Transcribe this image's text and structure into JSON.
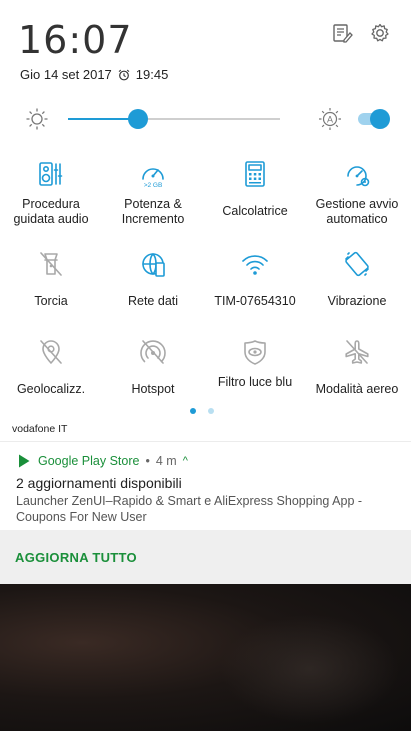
{
  "status": {
    "time": "16:07",
    "date": "Gio 14 set 2017",
    "alarm_time": "19:45",
    "icons": [
      "edit-notes-icon",
      "settings-gear-icon",
      "alarm-clock-icon"
    ]
  },
  "brightness": {
    "level": 0.33,
    "auto_enabled": true,
    "icons": [
      "brightness-sun-icon",
      "auto-brightness-icon"
    ]
  },
  "tiles": [
    {
      "label": "Procedura guidata audio",
      "icon": "audio-wizard-icon",
      "active": true
    },
    {
      "label": "Potenza & Incremento",
      "icon": "speedometer-boost-icon",
      "active": true,
      "badge": ">2 GB"
    },
    {
      "label": "Calcolatrice",
      "icon": "calculator-icon",
      "active": true
    },
    {
      "label": "Gestione avvio automatico",
      "icon": "autostart-manager-icon",
      "active": true
    },
    {
      "label": "Torcia",
      "icon": "flashlight-off-icon",
      "active": false
    },
    {
      "label": "Rete dati",
      "icon": "mobile-data-globe-icon",
      "active": true
    },
    {
      "label": "TIM-07654310",
      "icon": "wifi-icon",
      "active": true
    },
    {
      "label": "Vibrazione",
      "icon": "vibrate-icon",
      "active": true
    },
    {
      "label": "Geolocalizz.",
      "icon": "location-off-icon",
      "active": false
    },
    {
      "label": "Hotspot",
      "icon": "hotspot-off-icon",
      "active": false
    },
    {
      "label": "Filtro luce blu",
      "icon": "blue-light-filter-icon",
      "active": false
    },
    {
      "label": "Modalità aereo",
      "icon": "airplane-mode-icon",
      "active": false
    }
  ],
  "page_dots": {
    "count": 2,
    "current": 0
  },
  "carrier": "vodafone IT",
  "notification": {
    "app": "Google Play Store",
    "separator": "•",
    "time": "4 m",
    "expand_glyph": "^",
    "title": "2 aggiornamenti disponibili",
    "body": "Launcher ZenUI–Rapido & Smart e AliExpress Shopping App - Coupons For New User",
    "action": "AGGIORNA TUTTO",
    "icon": "play-store-icon"
  },
  "colors": {
    "accent": "#1e9bd6",
    "inactive": "#a8a8a8",
    "play_green": "#1a8f3a"
  }
}
